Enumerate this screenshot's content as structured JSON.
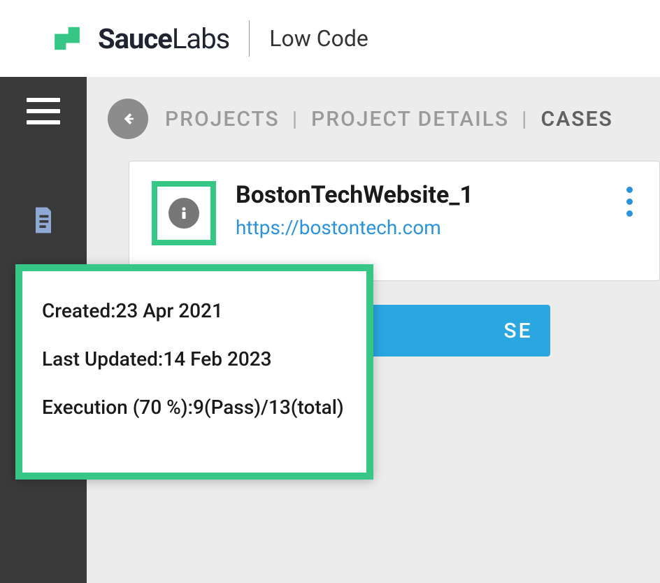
{
  "header": {
    "brand_bold": "Sauce",
    "brand_rest": "Labs",
    "product": "Low Code"
  },
  "breadcrumb": {
    "projects": "PROJECTS",
    "details": "PROJECT DETAILS",
    "cases": "CASES"
  },
  "project": {
    "name": "BostonTechWebsite_1",
    "url": "https://bostontech.com"
  },
  "button": {
    "se_fragment": "SE"
  },
  "tooltip": {
    "created_label": "Created:",
    "created_value": "23 Apr 2021",
    "updated_label": "Last Updated:",
    "updated_value": "14 Feb 2023",
    "exec_label": "Execution (70 %):",
    "exec_value": "9(Pass)/13(total)"
  }
}
